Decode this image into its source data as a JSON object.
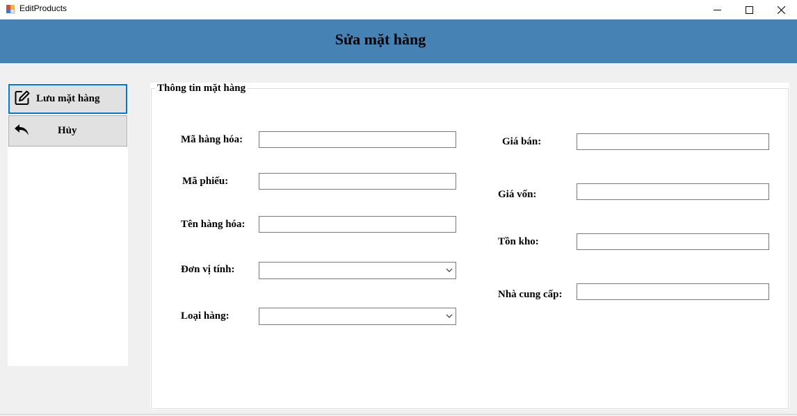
{
  "window": {
    "title": "EditProducts",
    "icon": "winforms-app-icon",
    "controls": [
      "minimize-icon",
      "maximize-icon",
      "close-icon"
    ]
  },
  "header": {
    "title": "Sửa mặt hàng",
    "background": "#4682b4"
  },
  "sidebar": {
    "save": {
      "label": "Lưu mặt hàng",
      "icon": "edit-icon"
    },
    "cancel": {
      "label": "Hủy",
      "icon": "undo-arrow-icon"
    }
  },
  "group": {
    "legend": "Thông tin mặt hàng"
  },
  "form": {
    "left": {
      "product_code": {
        "label": "Mã hàng hóa:",
        "value": ""
      },
      "receipt_code": {
        "label": "Mã phiếu:",
        "value": ""
      },
      "product_name": {
        "label": "Tên hàng hóa:",
        "value": ""
      },
      "unit": {
        "label": "Đơn vị tính:",
        "value": ""
      },
      "category": {
        "label": "Loại hàng:",
        "value": ""
      }
    },
    "right": {
      "sale_price": {
        "label": "Giá bán:",
        "value": ""
      },
      "cost_price": {
        "label": "Giá vốn:",
        "value": ""
      },
      "stock": {
        "label": "Tồn kho:",
        "value": ""
      },
      "supplier": {
        "label": "Nhà cung cấp:",
        "value": ""
      }
    }
  }
}
